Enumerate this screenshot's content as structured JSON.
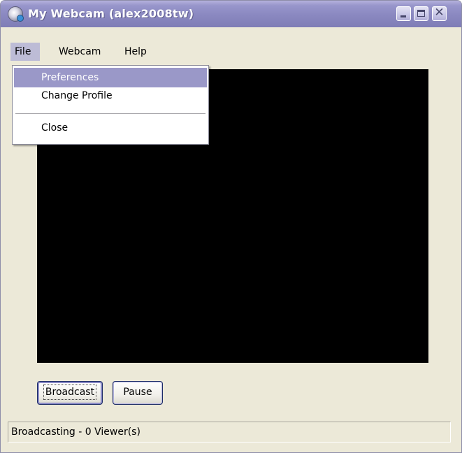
{
  "window": {
    "title": "My Webcam (alex2008tw)",
    "title_bar_color": "#8a88c0",
    "background_color": "#ECE9D8"
  },
  "title_buttons": {
    "minimize_icon": "minimize-icon",
    "maximize_icon": "maximize-icon",
    "close_glyph": "✕"
  },
  "menubar": {
    "file": "File",
    "webcam": "Webcam",
    "help": "Help"
  },
  "file_menu": {
    "open": true,
    "items": [
      {
        "label": "Preferences",
        "selected": true
      },
      {
        "label": "Change Profile",
        "selected": false
      },
      {
        "label": "Close",
        "selected": false
      }
    ],
    "highlight_color": "#9a98c8"
  },
  "video": {
    "background_color": "#000000"
  },
  "buttons": {
    "broadcast_label": "Broadcast",
    "pause_label": "Pause"
  },
  "status": {
    "text": "Broadcasting - 0 Viewer(s)"
  }
}
